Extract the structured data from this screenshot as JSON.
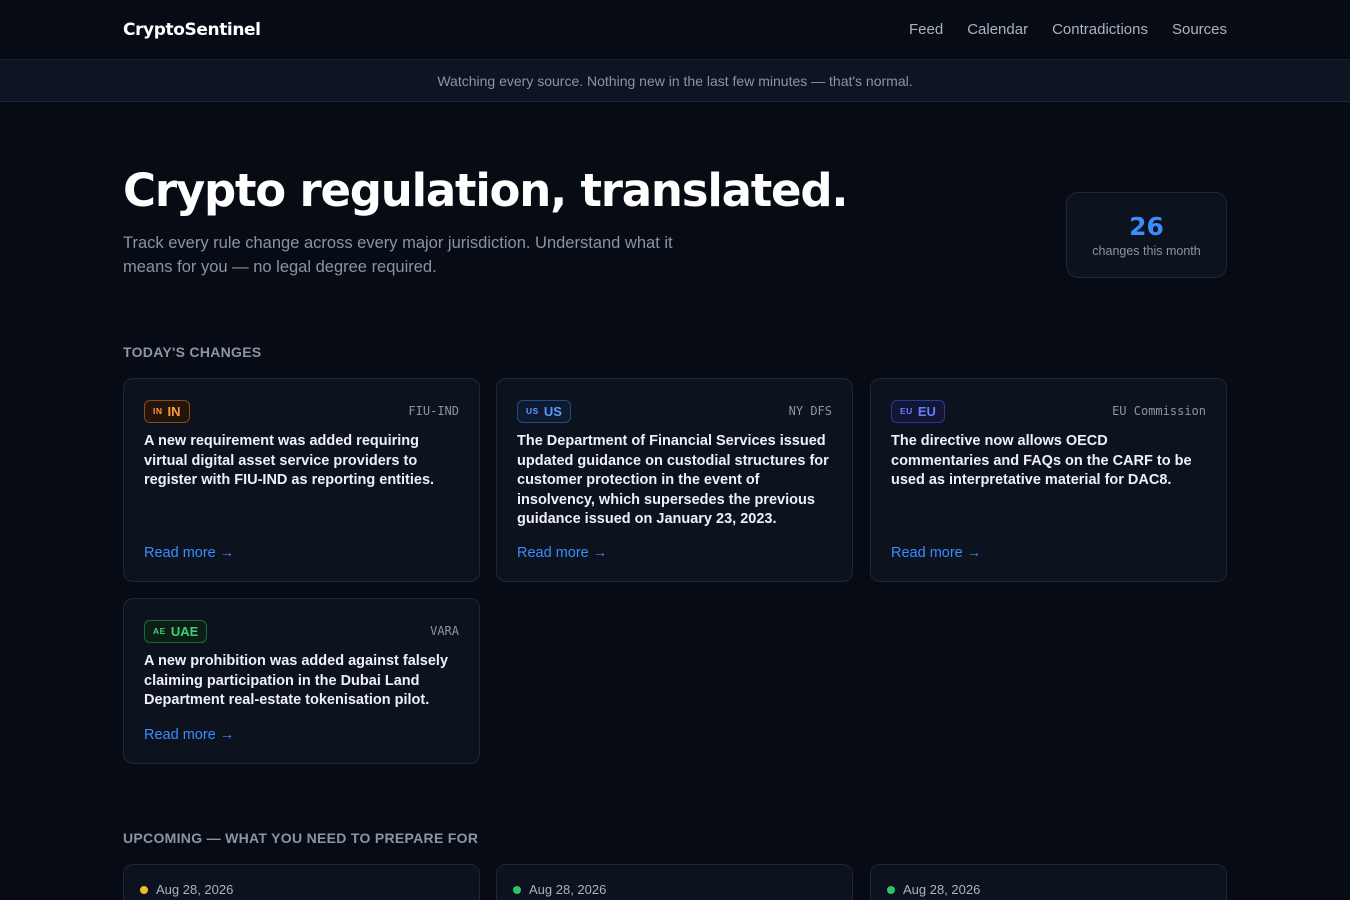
{
  "brand": "CryptoSentinel",
  "nav": [
    "Feed",
    "Calendar",
    "Contradictions",
    "Sources"
  ],
  "status": "Watching every source. Nothing new in the last few minutes — that's normal.",
  "hero": {
    "title": "Crypto regulation, translated.",
    "subtitle": "Track every rule change across every major jurisdiction. Understand what it means for you — no legal degree required."
  },
  "stat": {
    "value": "26",
    "label": "changes this month"
  },
  "today_title": "TODAY'S CHANGES",
  "changes": [
    {
      "code": "IN",
      "jurisdiction": "IN",
      "source": "FIU-IND",
      "text": "A new requirement was added requiring virtual digital asset service providers to register with FIU-IND as reporting entities.",
      "link": "Read more →"
    },
    {
      "code": "US",
      "jurisdiction": "US",
      "source": "NY DFS",
      "text": "The Department of Financial Services issued updated guidance on custodial structures for customer protection in the event of insolvency, which supersedes the previous guidance issued on January 23, 2023.",
      "link": "Read more →"
    },
    {
      "code": "EU",
      "jurisdiction": "EU",
      "source": "EU Commission",
      "text": "The directive now allows OECD commentaries and FAQs on the CARF to be used as interpretative material for DAC8.",
      "link": "Read more →"
    },
    {
      "code": "AE",
      "jurisdiction": "UAE",
      "source": "VARA",
      "text": "A new prohibition was added against falsely claiming participation in the Dubai Land Department real-estate tokenisation pilot.",
      "link": "Read more →"
    }
  ],
  "upcoming_title": "UPCOMING — WHAT YOU NEED TO PREPARE FOR",
  "upcoming": [
    {
      "date": "Aug 28, 2026",
      "dot_color": "#f5b731"
    },
    {
      "date": "Aug 28, 2026",
      "dot_color": "#2fc468"
    },
    {
      "date": "Aug 28, 2026",
      "dot_color": "#2fc468"
    }
  ],
  "colors": {
    "accent": "#3b8cff",
    "background": "#070b14",
    "card": "#0c121e"
  }
}
